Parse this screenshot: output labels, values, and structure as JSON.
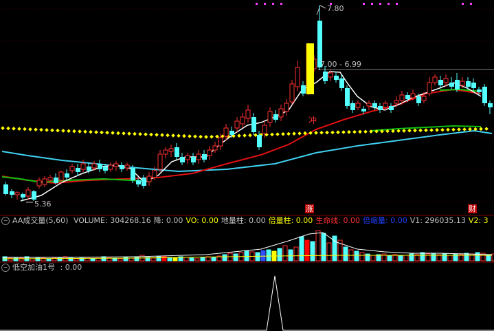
{
  "price_labels": {
    "high": "7.80",
    "low": "5.36",
    "range": "7.00 - 6.99"
  },
  "markers": {
    "chong": "冲",
    "zhang": "涨",
    "cai": "财"
  },
  "volume_panel": {
    "title": "AA成交量(5,60)",
    "items": [
      {
        "label": "VOLUME:",
        "value": "304268.16",
        "color": "#c0c0c0"
      },
      {
        "label": "降:",
        "value": "0.00",
        "color": "#c0c0c0"
      },
      {
        "label": "VO:",
        "value": "0.00",
        "color": "#ffff00"
      },
      {
        "label": "地量柱:",
        "value": "0.00",
        "color": "#c0c0c0"
      },
      {
        "label": "倍量柱:",
        "value": "0.00",
        "color": "#ffff00"
      },
      {
        "label": "生命线:",
        "value": "0.00",
        "color": "#ff3030"
      },
      {
        "label": "倍缩量:",
        "value": "0.00",
        "color": "#2040ff"
      },
      {
        "label": "V1:",
        "value": "296035.13",
        "color": "#c0c0c0"
      },
      {
        "label": "V2:",
        "value": "3",
        "color": "#ffff00"
      }
    ]
  },
  "indicator_panel": {
    "title": "低空加油1号",
    "value": ": 0.00"
  },
  "colors": {
    "up": "#ff3030",
    "down": "#54ffff",
    "ma_white": "#ffffff",
    "ma_red": "#e01010",
    "ma_green": "#10c010",
    "ma_cyan": "#40d0f0",
    "dots": "#ffff00",
    "divider": "#800000"
  }
}
